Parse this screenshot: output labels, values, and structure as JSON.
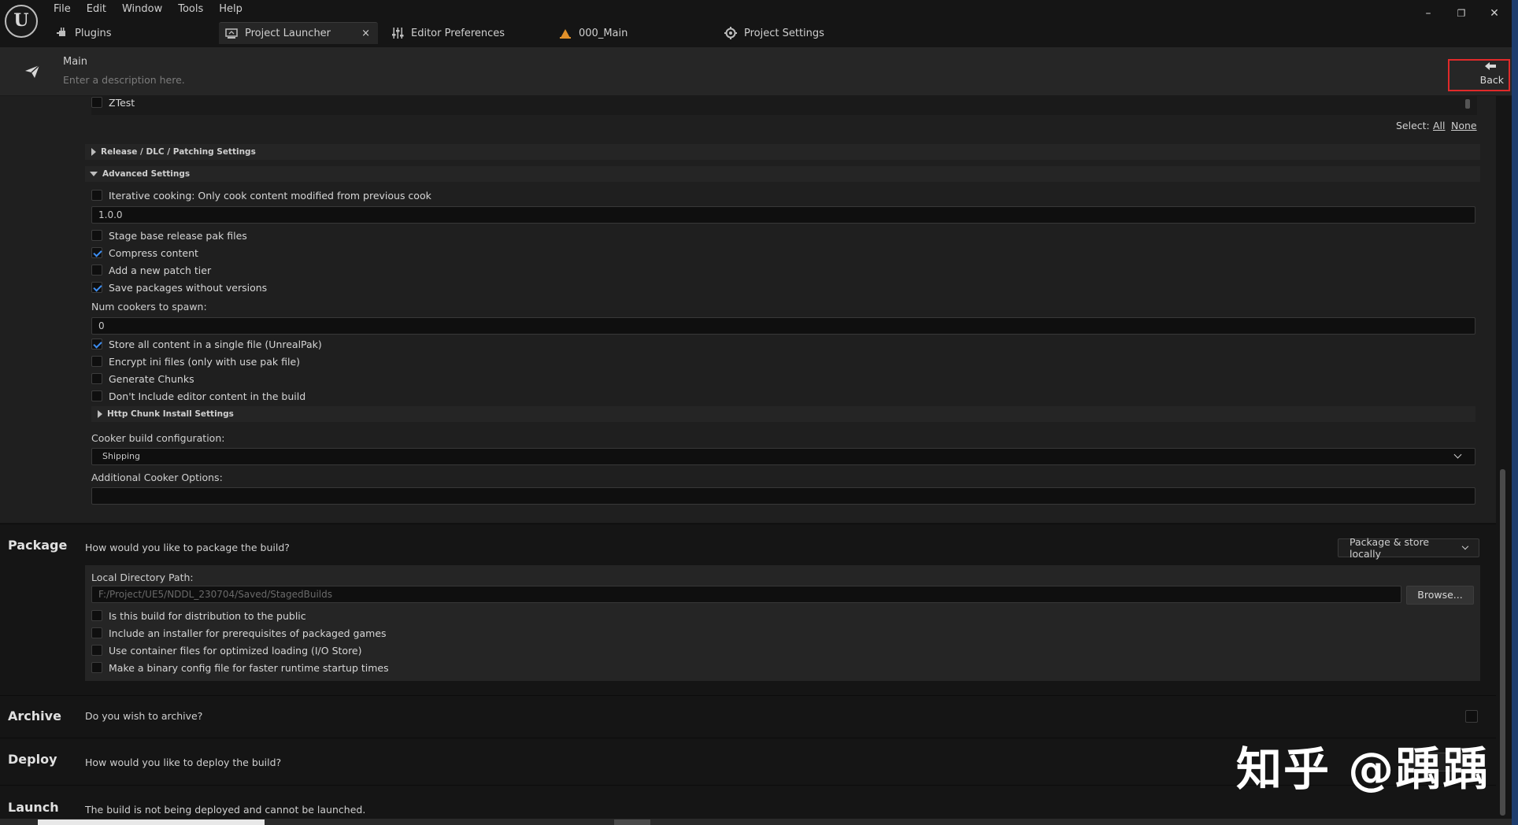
{
  "menu": [
    "File",
    "Edit",
    "Window",
    "Tools",
    "Help"
  ],
  "tabs": [
    {
      "label": "Plugins",
      "icon": "plug-icon"
    },
    {
      "label": "Project Launcher",
      "icon": "launcher-icon"
    },
    {
      "label": "Editor Preferences",
      "icon": "sliders-icon"
    },
    {
      "label": "000_Main",
      "icon": "level-icon"
    },
    {
      "label": "Project Settings",
      "icon": "settings-icon"
    }
  ],
  "window_controls": {
    "minimize": "–",
    "maximize": "❐",
    "close": "✕"
  },
  "header": {
    "title": "Main",
    "description": "Enter a description here.",
    "back_label": "Back"
  },
  "cook": {
    "last_map": "ZTest",
    "select_label": "Select:",
    "select_all": "All",
    "select_none": "None",
    "release_section": "Release / DLC / Patching Settings",
    "advanced_section": "Advanced Settings",
    "iterative_cooking": "Iterative cooking: Only cook content modified from previous cook",
    "version_value": "1.0.0",
    "options": [
      {
        "label": "Stage base release pak files",
        "checked": false
      },
      {
        "label": "Compress content",
        "checked": true
      },
      {
        "label": "Add a new patch tier",
        "checked": false
      },
      {
        "label": "Save packages without versions",
        "checked": true
      }
    ],
    "num_cookers_label": "Num cookers to spawn:",
    "num_cookers_value": "0",
    "pak_options": [
      {
        "label": "Store all content in a single file (UnrealPak)",
        "checked": true
      },
      {
        "label": "Encrypt ini files (only with use pak file)",
        "checked": false
      },
      {
        "label": "Generate Chunks",
        "checked": false
      },
      {
        "label": "Don't Include editor content in the build",
        "checked": false
      }
    ],
    "http_chunk_section": "Http Chunk Install Settings",
    "cooker_build_config_label": "Cooker build configuration:",
    "cooker_build_config_value": "Shipping",
    "additional_options_label": "Additional Cooker Options:",
    "additional_options_value": ""
  },
  "package": {
    "title": "Package",
    "question": "How would you like to package the build?",
    "mode": "Package & store locally",
    "local_dir_label": "Local Directory Path:",
    "local_dir_value": "F:/Project/UE5/NDDL_230704/Saved/StagedBuilds",
    "browse_label": "Browse...",
    "options": [
      {
        "label": "Is this build for distribution to the public",
        "checked": false
      },
      {
        "label": "Include an installer for prerequisites of packaged games",
        "checked": false
      },
      {
        "label": "Use container files for optimized loading (I/O Store)",
        "checked": false
      },
      {
        "label": "Make a binary config file for faster runtime startup times",
        "checked": false
      }
    ]
  },
  "archive": {
    "title": "Archive",
    "question": "Do you wish to archive?",
    "checked": false
  },
  "deploy": {
    "title": "Deploy",
    "question": "How would you like to deploy the build?"
  },
  "launch": {
    "title": "Launch",
    "message": "The build is not being deployed and cannot be launched."
  },
  "watermark": "知乎 @踽踽",
  "accent_color": "#3d8df0",
  "highlight_color": "#e02a2a"
}
